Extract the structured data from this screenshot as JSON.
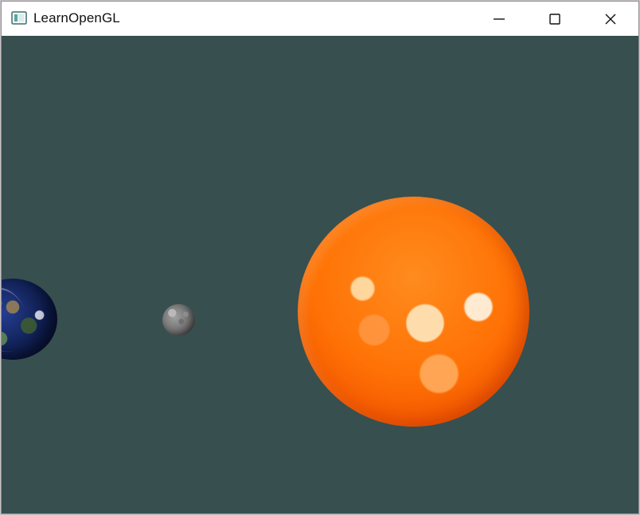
{
  "window": {
    "title": "LearnOpenGL"
  },
  "icons": {
    "app": "window-app-icon",
    "minimize": "minimize-icon",
    "maximize": "maximize-icon",
    "close": "close-icon"
  },
  "colors": {
    "viewport_background": "#374f4f",
    "titlebar_background": "#ffffff",
    "sun": "#ff7205",
    "moon": "#8f8f8f",
    "earth_ocean": "#0b1742"
  }
}
